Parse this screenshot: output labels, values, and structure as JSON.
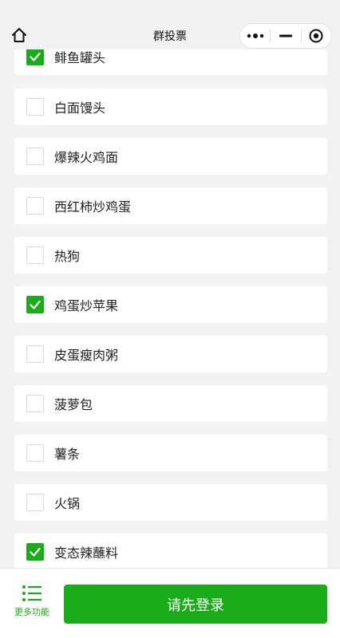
{
  "nav": {
    "title": "群投票",
    "icons": [
      "home-icon",
      "more-dots-icon",
      "minimize-icon",
      "close-target-icon"
    ]
  },
  "options": [
    {
      "label": "鲱鱼罐头",
      "checked": true
    },
    {
      "label": "白面馒头",
      "checked": false
    },
    {
      "label": "爆辣火鸡面",
      "checked": false
    },
    {
      "label": "西红柿炒鸡蛋",
      "checked": false
    },
    {
      "label": "热狗",
      "checked": false
    },
    {
      "label": "鸡蛋炒苹果",
      "checked": true
    },
    {
      "label": "皮蛋瘦肉粥",
      "checked": false
    },
    {
      "label": "菠萝包",
      "checked": false
    },
    {
      "label": "薯条",
      "checked": false
    },
    {
      "label": "火锅",
      "checked": false
    },
    {
      "label": "变态辣蘸料",
      "checked": true
    }
  ],
  "footer": {
    "more_label": "更多功能",
    "login_label": "请先登录"
  },
  "colors": {
    "accent": "#1aad19",
    "background": "#f2f2f2",
    "card": "#ffffff"
  }
}
